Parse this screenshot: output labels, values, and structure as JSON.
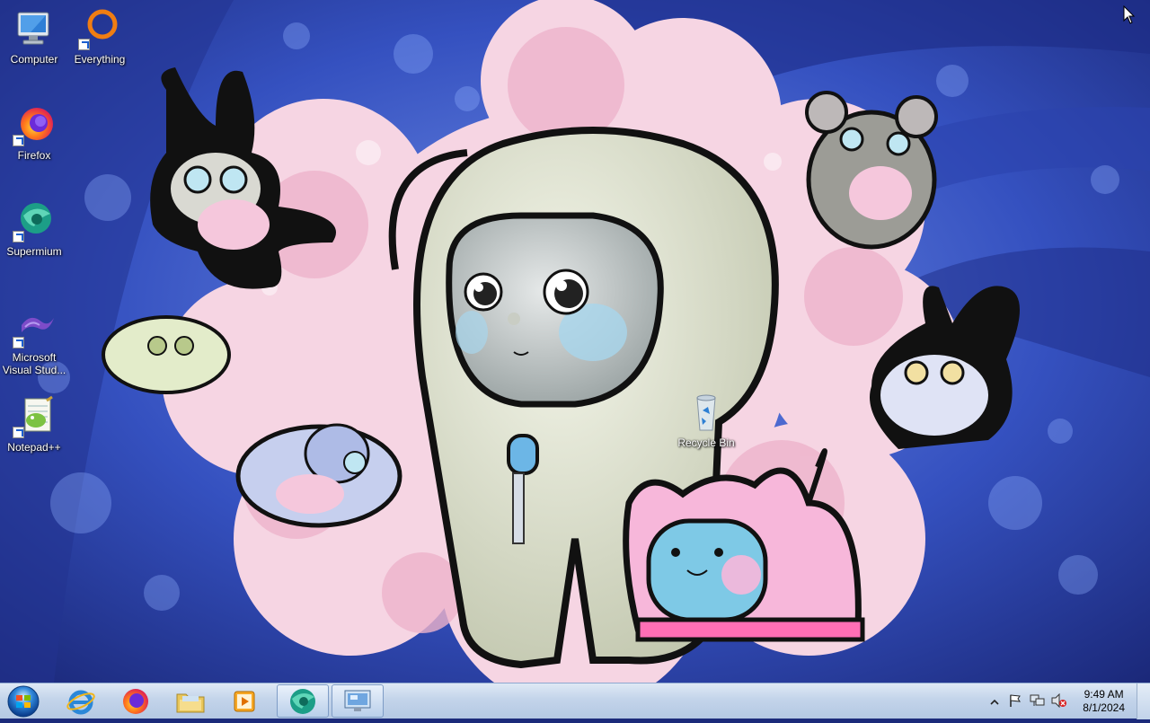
{
  "desktop": {
    "icons": [
      {
        "label": "Computer",
        "icon": "computer-icon"
      },
      {
        "label": "Everything",
        "icon": "everything-icon"
      },
      {
        "label": "Firefox",
        "icon": "firefox-icon"
      },
      {
        "label": "Supermium",
        "icon": "supermium-icon"
      },
      {
        "label": "Microsoft Visual Stud...",
        "icon": "visual-studio-icon"
      },
      {
        "label": "Notepad++",
        "icon": "notepadpp-icon"
      },
      {
        "label": "Recycle Bin",
        "icon": "recycle-bin-icon"
      }
    ]
  },
  "taskbar": {
    "start": "start-orb-icon",
    "pinned": [
      {
        "name": "internet-explorer",
        "icon": "ie-icon"
      },
      {
        "name": "firefox",
        "icon": "firefox-icon"
      },
      {
        "name": "file-explorer",
        "icon": "folder-icon"
      },
      {
        "name": "media-player",
        "icon": "media-player-icon"
      },
      {
        "name": "supermium",
        "icon": "supermium-icon"
      },
      {
        "name": "remote-desktop",
        "icon": "remote-desktop-icon"
      }
    ],
    "tray": {
      "time": "9:49 AM",
      "date": "8/1/2024"
    }
  },
  "colors": {
    "taskbar_top": "#dfe9f5",
    "taskbar_bottom": "#b4c8e3",
    "wallpaper_blue": "#2a3fa8",
    "wallpaper_pink": "#f3c4d8"
  }
}
